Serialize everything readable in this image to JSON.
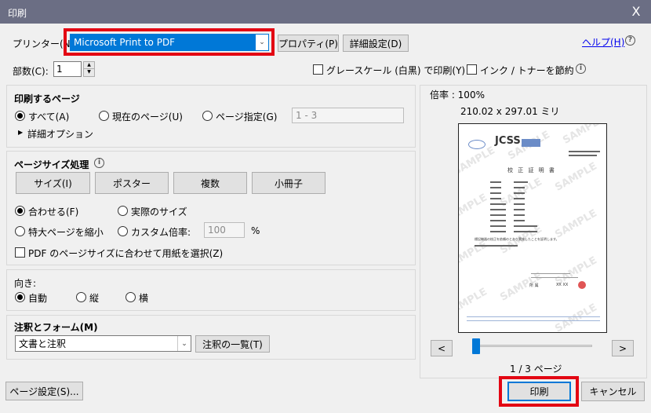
{
  "window": {
    "title": "印刷",
    "close": "X"
  },
  "printer": {
    "label": "プリンター(N):",
    "selected": "Microsoft Print to PDF",
    "properties": "プロパティ(P)",
    "advanced": "詳細設定(D)",
    "help": "ヘルプ(H)"
  },
  "copies": {
    "label": "部数(C):",
    "value": "1"
  },
  "options": {
    "grayscale": "グレースケール (白黒) で印刷(Y)",
    "ink_saver": "インク / トナーを節約"
  },
  "pages_to_print": {
    "title": "印刷するページ",
    "all": "すべて(A)",
    "current": "現在のページ(U)",
    "range": "ページ指定(G)",
    "range_value": "1 - 3",
    "more": "詳細オプション"
  },
  "page_sizing": {
    "title": "ページサイズ処理",
    "tabs": [
      "サイズ(I)",
      "ポスター",
      "複数",
      "小冊子"
    ],
    "fit": "合わせる(F)",
    "actual": "実際のサイズ",
    "shrink": "特大ページを縮小",
    "custom": "カスタム倍率:",
    "custom_value": "100",
    "percent": "%",
    "choose_paper": "PDF のページサイズに合わせて用紙を選択(Z)"
  },
  "orientation": {
    "title": "向き:",
    "auto": "自動",
    "portrait": "縦",
    "landscape": "横"
  },
  "comments": {
    "title": "注釈とフォーム(M)",
    "selected": "文書と注釈",
    "summarize": "注釈の一覧(T)"
  },
  "preview": {
    "zoom": "倍率 : 100%",
    "size": "210.02 x 297.01 ミリ",
    "page_info": "1 / 3 ページ",
    "prev": "<",
    "next": ">",
    "doc": {
      "logo": "JCSS",
      "heading": "校 正 証 明 書",
      "statement": "標記機器の校正を依頼のとおり実施したことを証明します。",
      "watermark": "SAMPLE",
      "signer": "所 属",
      "signature": "XX XX"
    }
  },
  "footer": {
    "page_setup": "ページ設定(S)...",
    "print": "印刷",
    "cancel": "キャンセル"
  }
}
